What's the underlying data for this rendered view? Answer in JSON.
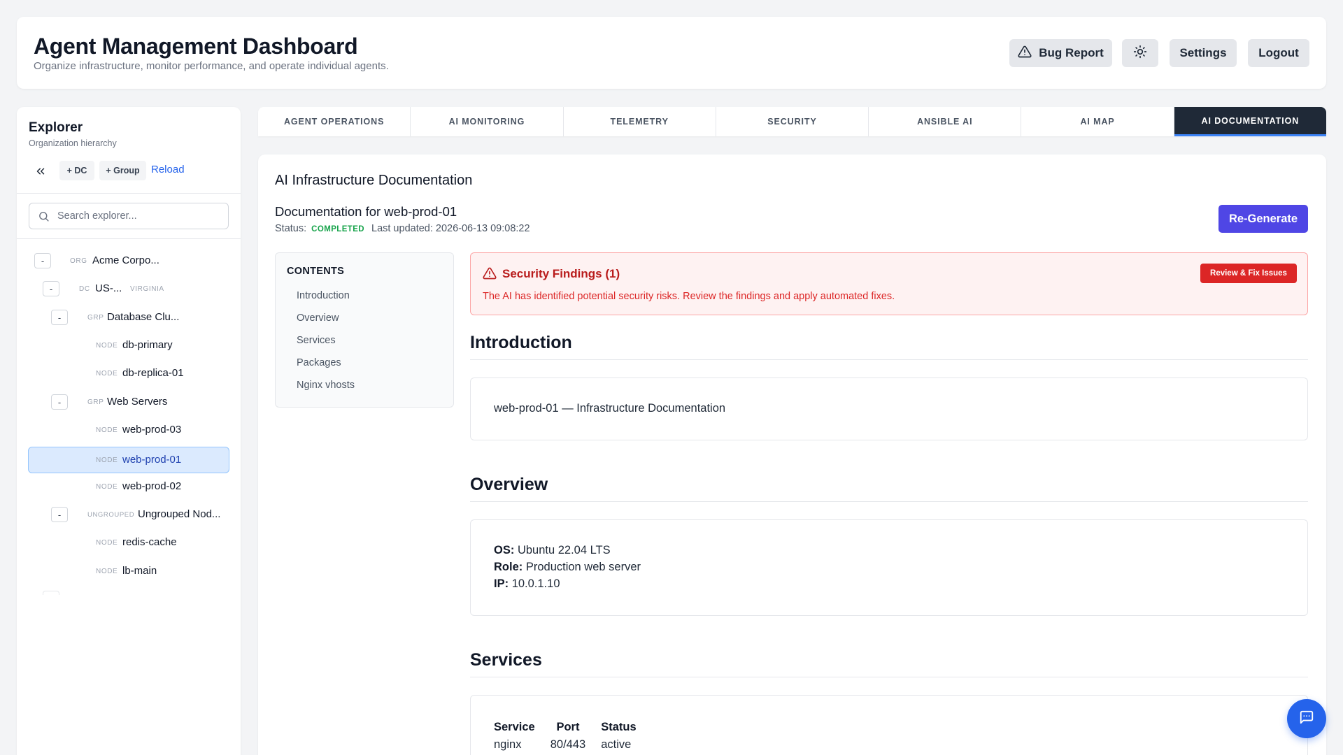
{
  "header": {
    "title": "Agent Management Dashboard",
    "subtitle": "Organize infrastructure, monitor performance, and operate individual agents.",
    "bug_report_label": "Bug Report",
    "theme_icon": "sun-icon",
    "settings_label": "Settings",
    "logout_label": "Logout"
  },
  "sidebar": {
    "title": "Explorer",
    "subtitle": "Organization hierarchy",
    "add_dc_label": "+ DC",
    "add_group_label": "+ Group",
    "reload_label": "Reload",
    "search_placeholder": "Search explorer...",
    "tree": [
      {
        "toggle": "-",
        "type": "ORG",
        "name": "Acme Corpo...",
        "meta": ""
      },
      {
        "toggle": "-",
        "type": "DC",
        "name": "US-...",
        "meta": "VIRGINIA"
      },
      {
        "toggle": "-",
        "type": "GRP",
        "name": "Database Clu...",
        "meta": ""
      },
      {
        "toggle": "",
        "type": "NODE",
        "name": "db-primary",
        "meta": ""
      },
      {
        "toggle": "",
        "type": "NODE",
        "name": "db-replica-01",
        "meta": ""
      },
      {
        "toggle": "-",
        "type": "GRP",
        "name": "Web Servers",
        "meta": ""
      },
      {
        "toggle": "",
        "type": "NODE",
        "name": "web-prod-03",
        "meta": ""
      },
      {
        "toggle": "",
        "type": "NODE",
        "name": "web-prod-01",
        "meta": "",
        "selected": true
      },
      {
        "toggle": "",
        "type": "NODE",
        "name": "web-prod-02",
        "meta": ""
      },
      {
        "toggle": "-",
        "type": "UNGROUPED",
        "name": "Ungrouped Nod...",
        "meta": ""
      },
      {
        "toggle": "",
        "type": "NODE",
        "name": "redis-cache",
        "meta": ""
      },
      {
        "toggle": "",
        "type": "NODE",
        "name": "lb-main",
        "meta": ""
      }
    ]
  },
  "tabs": [
    {
      "label": "AGENT OPERATIONS",
      "active": false
    },
    {
      "label": "AI MONITORING",
      "active": false
    },
    {
      "label": "TELEMETRY",
      "active": false
    },
    {
      "label": "SECURITY",
      "active": false
    },
    {
      "label": "ANSIBLE AI",
      "active": false
    },
    {
      "label": "AI MAP",
      "active": false
    },
    {
      "label": "AI DOCUMENTATION",
      "active": true
    }
  ],
  "main": {
    "title": "AI Infrastructure Documentation",
    "doc_title": "Documentation for web-prod-01",
    "status_label": "Status:",
    "status_value": "COMPLETED",
    "last_updated": "Last updated: 2026-06-13 09:08:22",
    "regenerate_label": "Re-Generate",
    "contents": {
      "heading": "CONTENTS",
      "items": [
        "Introduction",
        "Overview",
        "Services",
        "Packages",
        "Nginx vhosts"
      ]
    },
    "alert": {
      "title": "Security Findings (1)",
      "text": "The AI has identified potential security risks. Review the findings and apply automated fixes.",
      "button_label": "Review & Fix Issues"
    },
    "introduction": {
      "heading": "Introduction",
      "text": "web-prod-01 — Infrastructure Documentation"
    },
    "overview": {
      "heading": "Overview",
      "os_label": "OS:",
      "os_value": "Ubuntu 22.04 LTS",
      "role_label": "Role:",
      "role_value": "Production web server",
      "ip_label": "IP:",
      "ip_value": "10.0.1.10"
    },
    "services": {
      "heading": "Services",
      "columns": [
        "Service",
        "Port",
        "Status"
      ],
      "rows": [
        [
          "nginx",
          "80/443",
          "active"
        ]
      ]
    }
  },
  "chat_icon": "chat-icon",
  "colors": {
    "accent": "#4f46e5",
    "active_tab": "#1f2937",
    "danger": "#dc2626",
    "success": "#16a34a",
    "link": "#2563eb"
  }
}
